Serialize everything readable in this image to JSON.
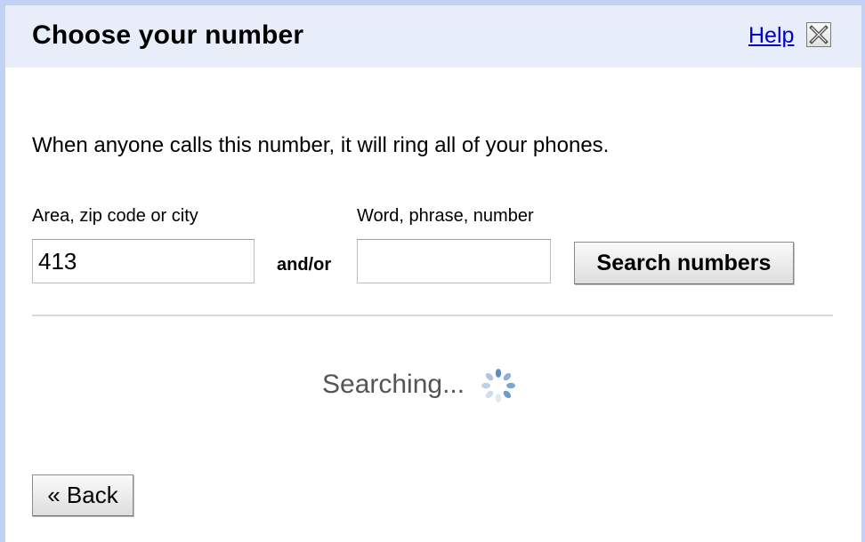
{
  "dialog": {
    "title": "Choose your number",
    "help_label": "Help",
    "close_icon": "close-icon"
  },
  "description": "When anyone calls this number, it will ring all of your phones.",
  "search": {
    "area_label": "Area, zip code or city",
    "area_value": "413",
    "connector": "and/or",
    "word_label": "Word, phrase, number",
    "word_value": "",
    "button_label": "Search numbers"
  },
  "status": {
    "text": "Searching...",
    "icon": "loading-spinner-icon"
  },
  "back_label": "« Back",
  "colors": {
    "titlebar_bg": "#e8eef9",
    "frame_border": "#c3d1f5",
    "link": "#0000cc",
    "status_text": "#555555",
    "spinner": "#5b8ec6"
  }
}
